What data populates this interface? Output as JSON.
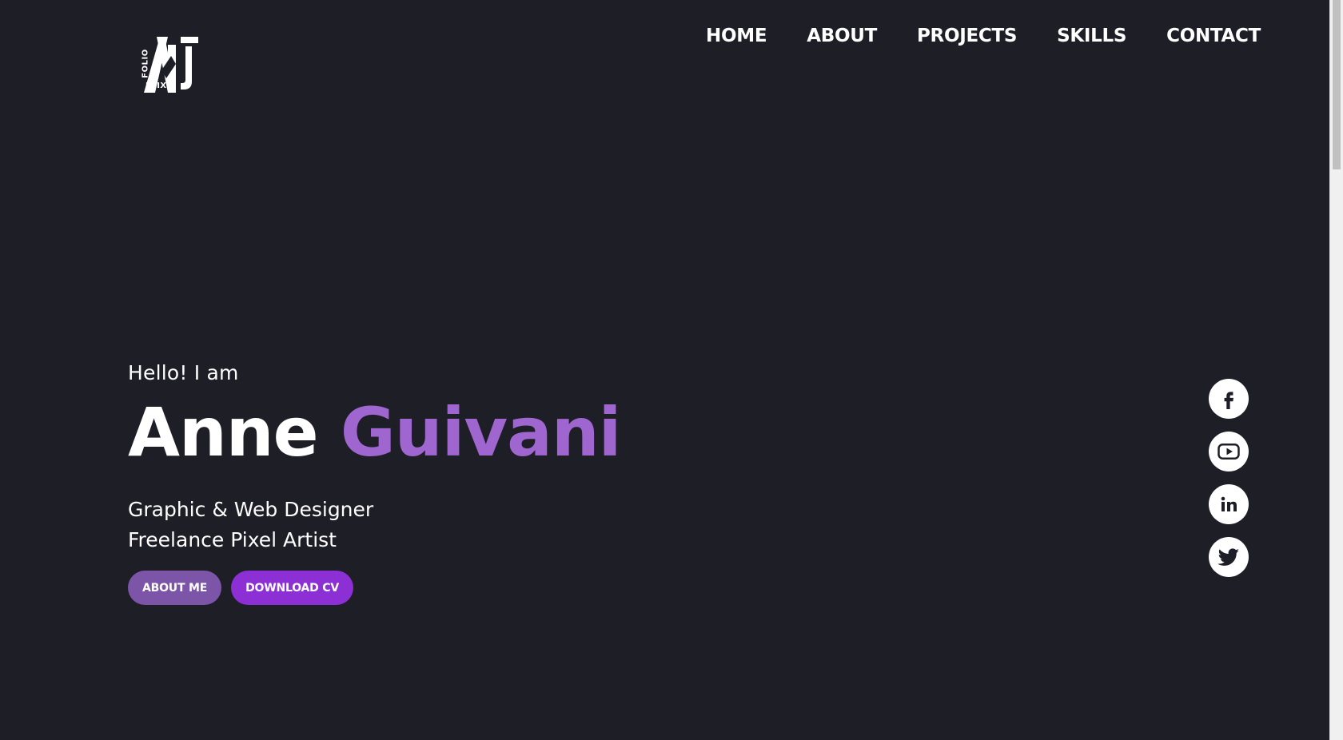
{
  "brand": {
    "logo_word_vertical": "FOLIO",
    "logo_word_horizontal": "FLIX"
  },
  "nav": {
    "items": [
      {
        "label": "HOME"
      },
      {
        "label": "ABOUT"
      },
      {
        "label": "PROJECTS"
      },
      {
        "label": "SKILLS"
      },
      {
        "label": "CONTACT"
      }
    ]
  },
  "hero": {
    "greeting": "Hello! I am",
    "first_name": "Anne",
    "last_name": "Guivani",
    "roles": [
      "Graphic & Web Designer",
      "Freelance Pixel Artist"
    ],
    "buttons": {
      "about": "ABOUT ME",
      "download": "DOWNLOAD CV"
    }
  },
  "social": [
    {
      "icon": "facebook-icon"
    },
    {
      "icon": "youtube-icon"
    },
    {
      "icon": "linkedin-icon"
    },
    {
      "icon": "twitter-icon"
    }
  ],
  "colors": {
    "background": "#1e1e27",
    "accent": "#a066cf",
    "button_about": "#7c55a8",
    "button_download": "#8c2fd4",
    "text": "#ffffff"
  }
}
